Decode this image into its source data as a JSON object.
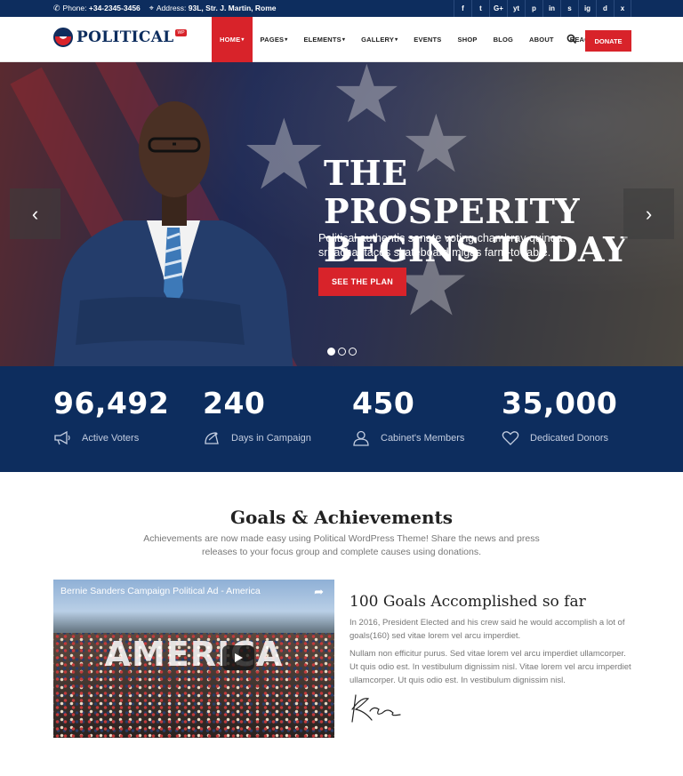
{
  "topbar": {
    "phone_label": "Phone:",
    "phone": "+34-2345-3456",
    "address_label": "Address:",
    "address": "93L, Str. J. Martin, Rome",
    "social": [
      "f",
      "t",
      "G+",
      "yt",
      "p",
      "in",
      "s",
      "ig",
      "d",
      "x"
    ]
  },
  "header": {
    "logo_text": "POLITICAL",
    "logo_tag": "WP",
    "nav": [
      {
        "label": "HOME",
        "caret": true
      },
      {
        "label": "PAGES",
        "caret": true
      },
      {
        "label": "ELEMENTS",
        "caret": true
      },
      {
        "label": "GALLERY",
        "caret": true
      },
      {
        "label": "EVENTS",
        "caret": false
      },
      {
        "label": "SHOP",
        "caret": false
      },
      {
        "label": "BLOG",
        "caret": false
      },
      {
        "label": "ABOUT",
        "caret": false
      },
      {
        "label": "REACH US",
        "caret": false
      }
    ],
    "donate_label": "DONATE"
  },
  "hero": {
    "title_line1": "THE PROSPERITY",
    "title_line2": "BEGINS TODAY",
    "subtitle_line1": "Political authentic senate voting chambray quinoa.",
    "subtitle_line2": "sriracha, tacos skateboard migas farm-to-table.",
    "button_label": "SEE THE PLAN",
    "slide_count": 3,
    "active_slide": 1
  },
  "stats": [
    {
      "number": "96,492",
      "label": "Active Voters",
      "icon": "megaphone-icon"
    },
    {
      "number": "240",
      "label": "Days in Campaign",
      "icon": "satellite-icon"
    },
    {
      "number": "450",
      "label": "Cabinet's Members",
      "icon": "person-icon"
    },
    {
      "number": "35,000",
      "label": "Dedicated Donors",
      "icon": "heart-icon"
    }
  ],
  "goals": {
    "title": "Goals & Achievements",
    "description_line1": "Achievements are now made easy using Political WordPress Theme! Share the news and press",
    "description_line2": "releases to your focus group and complete causes using donations."
  },
  "video": {
    "title": "Bernie Sanders Campaign Political Ad - America",
    "overlay_text": "AMERICA"
  },
  "accomplishments": {
    "title": "100 Goals Accomplished so far",
    "paragraph1": "In 2016, President Elected and his crew said he would accomplish a lot of goals(160) sed vitae lorem vel arcu imperdiet.",
    "paragraph2": "Nullam non efficitur purus. Sed vitae lorem vel arcu imperdiet ullamcorper. Ut quis odio est. In vestibulum dignissim nisl. Vitae lorem vel arcu imperdiet ullamcorper. Ut quis odio est. In vestibulum dignissim nisl."
  },
  "colors": {
    "navy": "#0d2d5e",
    "red": "#d8232a"
  }
}
